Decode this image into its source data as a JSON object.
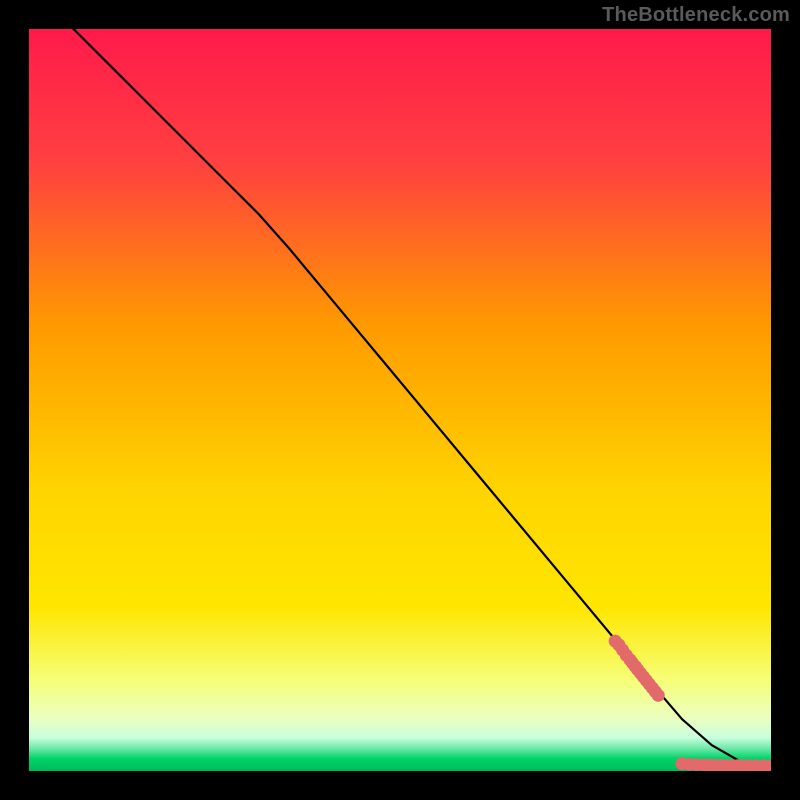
{
  "watermark": "TheBottleneck.com",
  "chart_data": {
    "type": "line",
    "title": "",
    "xlabel": "",
    "ylabel": "",
    "xlim": [
      0,
      100
    ],
    "ylim": [
      0,
      100
    ],
    "grid": false,
    "background_gradient": {
      "top": "#ff1a4b",
      "mid1": "#ff9a00",
      "mid2": "#ffe600",
      "mid3": "#f5ff7a",
      "bottom_band": "#00d46a"
    },
    "series": [
      {
        "name": "curve",
        "type": "line",
        "color": "#000000",
        "x": [
          6,
          10,
          15,
          20,
          25,
          28,
          31,
          35,
          40,
          45,
          50,
          55,
          60,
          65,
          70,
          75,
          80,
          82,
          85,
          88,
          92,
          96,
          100
        ],
        "y": [
          100,
          96,
          91,
          86,
          81,
          78,
          75,
          70.5,
          64.5,
          58.5,
          52.5,
          46.5,
          40.5,
          34.5,
          28.5,
          22.5,
          16.5,
          14,
          10.5,
          7,
          3.5,
          1.2,
          0.5
        ]
      },
      {
        "name": "points-upper-cluster",
        "type": "scatter",
        "color": "#e36a6a",
        "x": [
          79,
          79.5,
          80,
          80.5,
          81,
          81.3,
          81.7,
          82,
          82.4,
          82.8,
          83.2,
          83.6,
          84,
          84.4,
          84.8
        ],
        "y": [
          17.5,
          17,
          16.3,
          15.6,
          15,
          14.6,
          14.1,
          13.7,
          13.2,
          12.7,
          12.2,
          11.7,
          11.2,
          10.7,
          10.2
        ]
      },
      {
        "name": "points-lower-tail",
        "type": "scatter",
        "color": "#e36a6a",
        "x": [
          88,
          89,
          90,
          91,
          91.8,
          92.5,
          93.2,
          94,
          94.8,
          95.5,
          96.2,
          97,
          98,
          99,
          100
        ],
        "y": [
          1.0,
          0.9,
          0.85,
          0.8,
          0.78,
          0.76,
          0.74,
          0.72,
          0.7,
          0.7,
          0.7,
          0.7,
          0.7,
          0.7,
          0.7
        ]
      }
    ]
  }
}
